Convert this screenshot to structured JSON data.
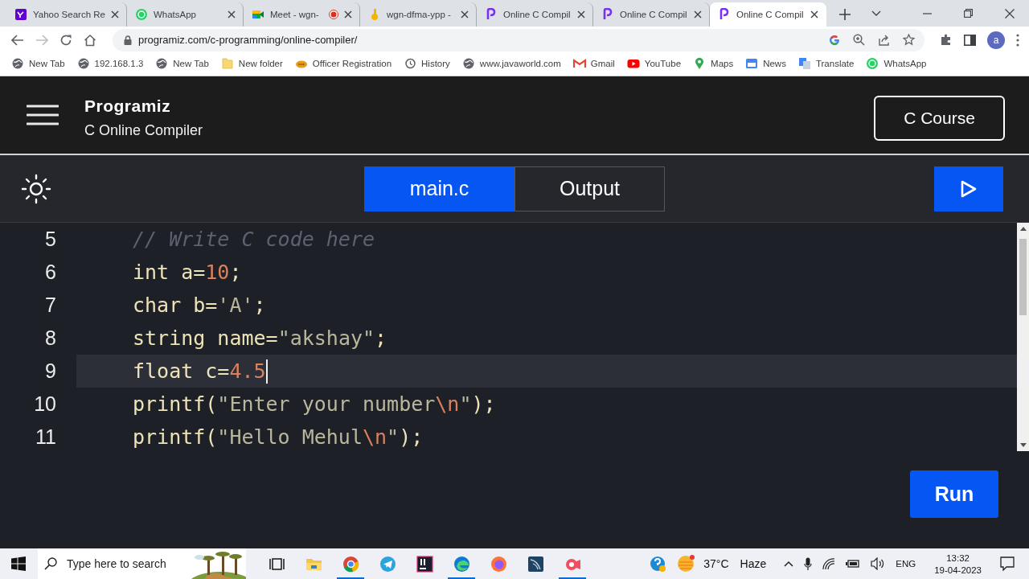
{
  "browser": {
    "tabs": [
      {
        "title": "Yahoo Search Re",
        "kind": "yahoo",
        "selected": false,
        "recording": false
      },
      {
        "title": "WhatsApp",
        "kind": "whatsapp",
        "selected": false,
        "recording": false
      },
      {
        "title": "Meet - wgn-",
        "kind": "meet",
        "selected": false,
        "recording": true
      },
      {
        "title": "wgn-dfma-ypp -",
        "kind": "drive",
        "selected": false,
        "recording": false
      },
      {
        "title": "Online C Compil",
        "kind": "programiz",
        "selected": false,
        "recording": false
      },
      {
        "title": "Online C Compil",
        "kind": "programiz",
        "selected": false,
        "recording": false
      },
      {
        "title": "Online C Compil",
        "kind": "programiz",
        "selected": true,
        "recording": false
      }
    ],
    "address": "programiz.com/c-programming/online-compiler/",
    "profile": "a",
    "bookmarks": [
      {
        "label": "New Tab",
        "kind": "globe"
      },
      {
        "label": "192.168.1.3",
        "kind": "globe"
      },
      {
        "label": "New Tab",
        "kind": "globe"
      },
      {
        "label": "New folder",
        "kind": "folder"
      },
      {
        "label": "Officer Registration",
        "kind": "blob"
      },
      {
        "label": "History",
        "kind": "history"
      },
      {
        "label": "www.javaworld.com",
        "kind": "globe"
      },
      {
        "label": "Gmail",
        "kind": "mail"
      },
      {
        "label": "YouTube",
        "kind": "play"
      },
      {
        "label": "Maps",
        "kind": "pin"
      },
      {
        "label": "News",
        "kind": "news"
      },
      {
        "label": "Translate",
        "kind": "translate"
      },
      {
        "label": "WhatsApp",
        "kind": "whatsapp"
      }
    ]
  },
  "header": {
    "logo": "Programiz",
    "subtitle": "C Online Compiler",
    "course_button": "C Course"
  },
  "toolbar": {
    "tabs": [
      {
        "label": "main.c",
        "selected": true
      },
      {
        "label": "Output",
        "selected": false
      }
    ]
  },
  "editor": {
    "lines": [
      {
        "number": "5",
        "active": false,
        "caret": false,
        "tokens": [
          {
            "kind": "comment",
            "text": "// Write C code here"
          }
        ]
      },
      {
        "number": "6",
        "active": false,
        "caret": false,
        "tokens": [
          {
            "kind": "plain",
            "text": "int a="
          },
          {
            "kind": "number",
            "text": "10"
          },
          {
            "kind": "plain",
            "text": ";"
          }
        ]
      },
      {
        "number": "7",
        "active": false,
        "caret": false,
        "tokens": [
          {
            "kind": "plain",
            "text": "char b="
          },
          {
            "kind": "string",
            "text": "'A'"
          },
          {
            "kind": "plain",
            "text": ";"
          }
        ]
      },
      {
        "number": "8",
        "active": false,
        "caret": false,
        "tokens": [
          {
            "kind": "plain",
            "text": "string name="
          },
          {
            "kind": "string",
            "text": "\"akshay\""
          },
          {
            "kind": "plain",
            "text": ";"
          }
        ]
      },
      {
        "number": "9",
        "active": true,
        "caret": true,
        "tokens": [
          {
            "kind": "plain",
            "text": "float c="
          },
          {
            "kind": "number",
            "text": "4.5"
          }
        ]
      },
      {
        "number": "10",
        "active": false,
        "caret": false,
        "tokens": [
          {
            "kind": "plain",
            "text": "printf("
          },
          {
            "kind": "string",
            "text": "\"Enter your number"
          },
          {
            "kind": "escape",
            "text": "\\n"
          },
          {
            "kind": "string",
            "text": "\""
          },
          {
            "kind": "plain",
            "text": ");"
          }
        ]
      },
      {
        "number": "11",
        "active": false,
        "caret": false,
        "tokens": [
          {
            "kind": "plain",
            "text": "printf("
          },
          {
            "kind": "string",
            "text": "\"Hello Mehul"
          },
          {
            "kind": "escape",
            "text": "\\n"
          },
          {
            "kind": "string",
            "text": "\""
          },
          {
            "kind": "plain",
            "text": ");"
          }
        ]
      }
    ],
    "run_button": "Run"
  },
  "taskbar": {
    "search_placeholder": "Type here to search",
    "apps": [
      {
        "kind": "taskview",
        "active": false
      },
      {
        "kind": "files",
        "active": false
      },
      {
        "kind": "chrome",
        "active": true
      },
      {
        "kind": "telegram",
        "active": false
      },
      {
        "kind": "jetbrains",
        "active": false
      },
      {
        "kind": "edge",
        "active": true
      },
      {
        "kind": "firefox",
        "active": false
      },
      {
        "kind": "dolphin",
        "active": false
      },
      {
        "kind": "camera",
        "active": true
      },
      {
        "kind": "help",
        "active": false
      }
    ],
    "temperature": "37°C",
    "weather": "Haze",
    "language": "ENG",
    "time": "13:32",
    "date": "19-04-2023"
  }
}
